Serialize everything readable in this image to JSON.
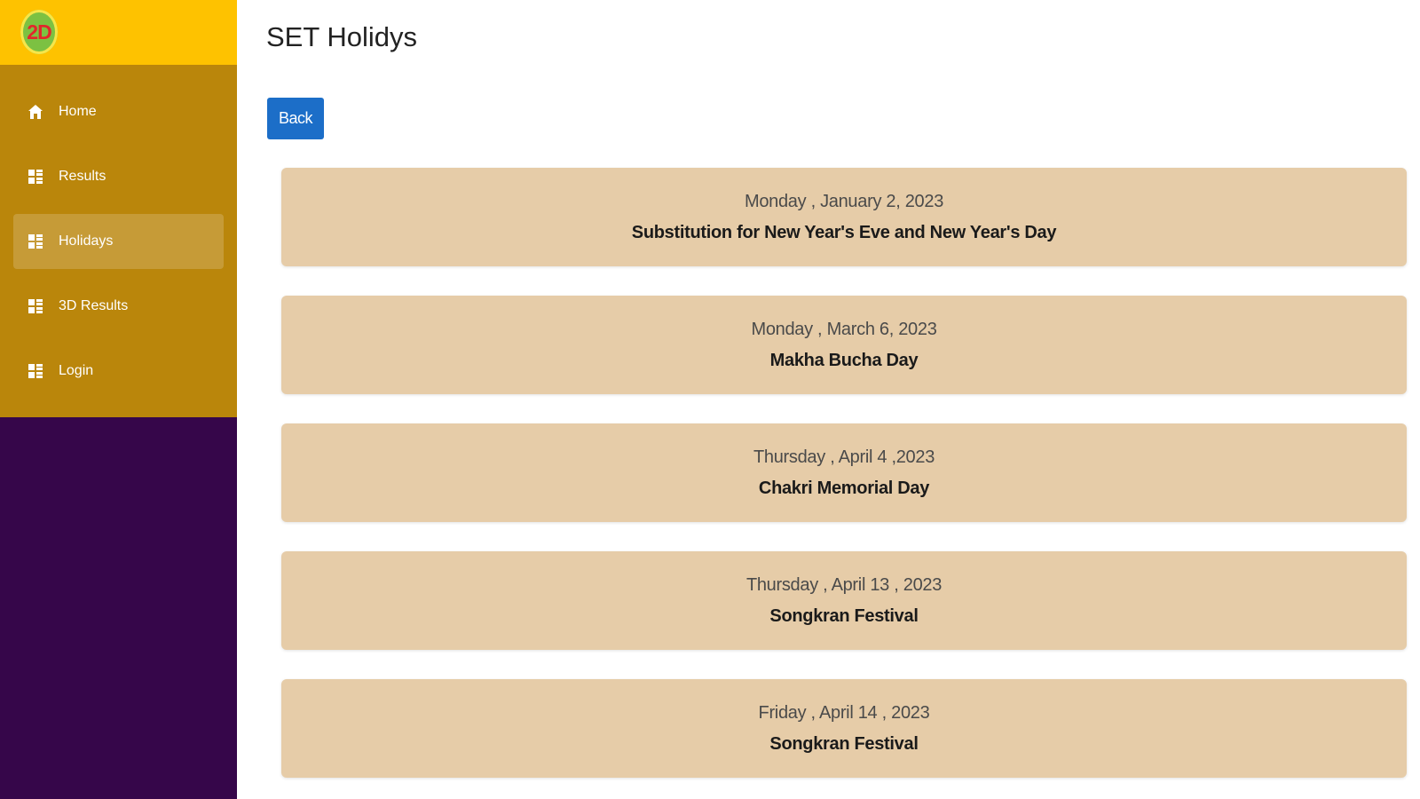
{
  "app": {
    "logo_text": "2D"
  },
  "sidebar": {
    "items": [
      {
        "label": "Home",
        "icon": "home-icon"
      },
      {
        "label": "Results",
        "icon": "list-icon"
      },
      {
        "label": "Holidays",
        "icon": "list-icon",
        "active": true
      },
      {
        "label": "3D Results",
        "icon": "list-icon"
      },
      {
        "label": "Login",
        "icon": "list-icon"
      }
    ]
  },
  "page": {
    "title": "SET Holidys",
    "back_label": "Back"
  },
  "holidays": [
    {
      "date": "Monday , January 2, 2023",
      "name": "Substitution for New Year's Eve and New Year's Day"
    },
    {
      "date": "Monday , March 6, 2023",
      "name": "Makha Bucha Day"
    },
    {
      "date": "Thursday , April 4 ,2023",
      "name": "Chakri Memorial Day"
    },
    {
      "date": "Thursday , April 13 , 2023",
      "name": "Songkran Festival"
    },
    {
      "date": "Friday , April 14 , 2023",
      "name": "Songkran Festival"
    }
  ],
  "colors": {
    "logo_bar": "#fec200",
    "nav_bg": "#ba860b",
    "sidebar_bottom": "#36064a",
    "card_bg": "#e6cca8",
    "button": "#1c6ec8"
  }
}
